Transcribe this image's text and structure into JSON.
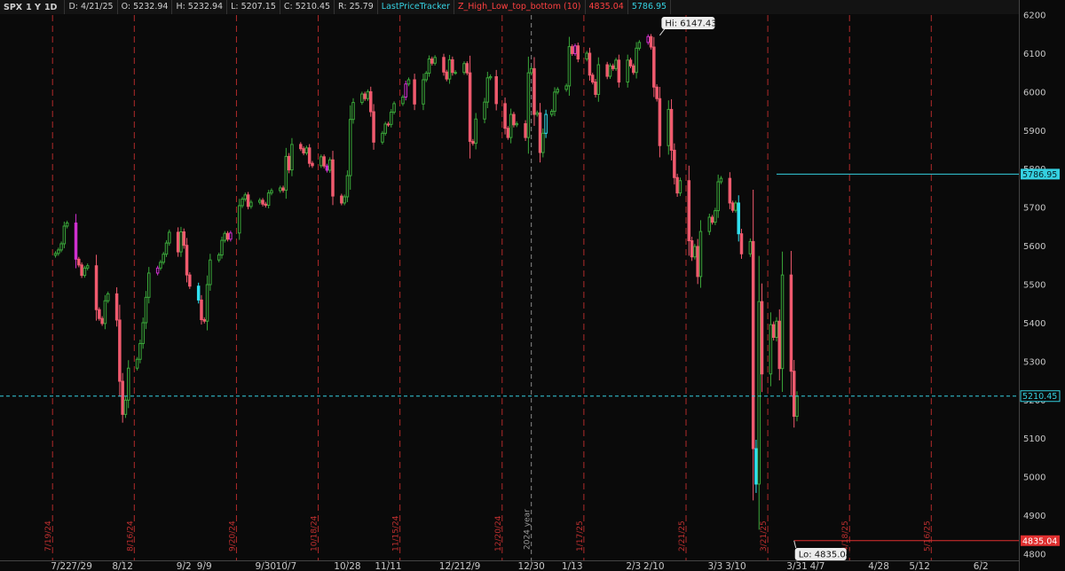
{
  "header": {
    "symbol": "SPX",
    "period": "1 Y",
    "interval": "1D",
    "date": "D: 4/21/25",
    "open": "O: 5232.94",
    "high": "H: 5232.94",
    "low": "L: 5207.15",
    "close": "C: 5210.45",
    "range": "R: 25.79",
    "study1": "LastPriceTracker",
    "study2": "Z_High_Low_top_bottom (10)",
    "study2_v1": "4835.04",
    "study2_v2": "5786.95"
  },
  "chart_data": {
    "type": "candlestick",
    "ylim": [
      4800,
      6200
    ],
    "y_ticks": [
      4800,
      4900,
      5000,
      5100,
      5200,
      5300,
      5400,
      5500,
      5600,
      5700,
      5800,
      5900,
      6000,
      6100,
      6200
    ],
    "x_ticks": [
      "7/22",
      "7/29",
      "8/12",
      "9/2",
      "9/9",
      "9/30",
      "10/7",
      "10/28",
      "11/11",
      "12/2",
      "12/9",
      "12/30",
      "1/13",
      "2/3",
      "2/10",
      "3/3",
      "3/10",
      "3/31",
      "4/7",
      "4/28",
      "5/12",
      "6/2"
    ],
    "x_tick_days": [
      2,
      9,
      23,
      44,
      51,
      72,
      79,
      100,
      114,
      135,
      142,
      163,
      177,
      198,
      205,
      226,
      233,
      254,
      261,
      282,
      296,
      317
    ],
    "x_range_days": [
      -19,
      330
    ],
    "year_divider": {
      "label": "2024 year",
      "day": 163
    },
    "markers": [
      {
        "label": "7/19/24",
        "day": -1
      },
      {
        "label": "8/16/24",
        "day": 27
      },
      {
        "label": "9/20/24",
        "day": 62
      },
      {
        "label": "10/18/24",
        "day": 90
      },
      {
        "label": "11/15/24",
        "day": 118
      },
      {
        "label": "12/20/24",
        "day": 153
      },
      {
        "label": "1/17/25",
        "day": 181
      },
      {
        "label": "2/21/25",
        "day": 216
      },
      {
        "label": "3/21/25",
        "day": 244
      },
      {
        "label": "4/18/25",
        "day": 272
      },
      {
        "label": "5/16/25",
        "day": 300
      }
    ],
    "last_price": {
      "value": 5210.45,
      "label": "5210.45"
    },
    "level_high": {
      "value": 5786.95,
      "label": "5786.95",
      "start_day": 247
    },
    "level_low": {
      "value": 4835.04,
      "label": "4835.04",
      "start_day": 253
    },
    "hi_callout": {
      "label": "Hi: 6147.43",
      "value": 6147.43,
      "day": 207
    },
    "lo_callout": {
      "label": "Lo: 4835.04",
      "value": 4835.04,
      "day": 253
    },
    "colors": {
      "up": "#3aa83a",
      "down": "#f05a6e",
      "hi_bar": "#d030d0",
      "lo_bar": "#30e0f0",
      "marker": "#b02a2a",
      "tracker": "#35d0e0",
      "level_low": "#e03030"
    },
    "closes": [
      [
        0,
        5581
      ],
      [
        1,
        5590
      ],
      [
        2,
        5606
      ],
      [
        3,
        5652
      ],
      [
        4,
        5660
      ],
      [
        7,
        5566
      ],
      [
        8,
        5551
      ],
      [
        9,
        5524
      ],
      [
        10,
        5543
      ],
      [
        11,
        5549
      ],
      [
        14,
        5435
      ],
      [
        15,
        5412
      ],
      [
        16,
        5399
      ],
      [
        17,
        5458
      ],
      [
        18,
        5476
      ],
      [
        21,
        5408
      ],
      [
        22,
        5249
      ],
      [
        23,
        5163
      ],
      [
        24,
        5200
      ],
      [
        25,
        5283
      ],
      [
        28,
        5306
      ],
      [
        29,
        5347
      ],
      [
        30,
        5401
      ],
      [
        31,
        5467
      ],
      [
        32,
        5530
      ],
      [
        35,
        5543
      ],
      [
        36,
        5558
      ],
      [
        37,
        5579
      ],
      [
        38,
        5608
      ],
      [
        39,
        5636
      ],
      [
        42,
        5585
      ],
      [
        43,
        5637
      ],
      [
        44,
        5602
      ],
      [
        45,
        5525
      ],
      [
        46,
        5496
      ],
      [
        49,
        5460
      ],
      [
        50,
        5409
      ],
      [
        51,
        5405
      ],
      [
        52,
        5500
      ],
      [
        53,
        5564
      ],
      [
        56,
        5577
      ],
      [
        57,
        5615
      ],
      [
        58,
        5633
      ],
      [
        59,
        5618
      ],
      [
        60,
        5634
      ],
      [
        63,
        5705
      ],
      [
        64,
        5722
      ],
      [
        65,
        5733
      ],
      [
        66,
        5703
      ],
      [
        67,
        5714
      ],
      [
        70,
        5719
      ],
      [
        71,
        5709
      ],
      [
        72,
        5706
      ],
      [
        73,
        5738
      ],
      [
        74,
        5744
      ],
      [
        77,
        5751
      ],
      [
        78,
        5745
      ],
      [
        79,
        5833
      ],
      [
        80,
        5798
      ],
      [
        81,
        5864
      ],
      [
        84,
        5853
      ],
      [
        85,
        5842
      ],
      [
        86,
        5855
      ],
      [
        87,
        5815
      ],
      [
        88,
        5809
      ],
      [
        91,
        5832
      ],
      [
        92,
        5808
      ],
      [
        93,
        5797
      ],
      [
        94,
        5824
      ],
      [
        95,
        5730
      ],
      [
        98,
        5712
      ],
      [
        99,
        5728
      ],
      [
        100,
        5783
      ],
      [
        101,
        5929
      ],
      [
        102,
        5973
      ],
      [
        105,
        5995
      ],
      [
        106,
        5983
      ],
      [
        107,
        6001
      ],
      [
        108,
        5949
      ],
      [
        109,
        5870
      ],
      [
        112,
        5893
      ],
      [
        113,
        5917
      ],
      [
        114,
        5916
      ],
      [
        115,
        5948
      ],
      [
        116,
        5970
      ],
      [
        119,
        5987
      ],
      [
        120,
        6021
      ],
      [
        121,
        6032
      ],
      [
        123,
        5969
      ],
      [
        126,
        6032
      ],
      [
        127,
        6049
      ],
      [
        128,
        6086
      ],
      [
        129,
        6075
      ],
      [
        130,
        6090
      ],
      [
        133,
        6052
      ],
      [
        134,
        6034
      ],
      [
        135,
        6084
      ],
      [
        136,
        6051
      ],
      [
        137,
        6051
      ],
      [
        140,
        6074
      ],
      [
        141,
        6050
      ],
      [
        142,
        5872
      ],
      [
        143,
        5867
      ],
      [
        144,
        5930
      ],
      [
        147,
        5974
      ],
      [
        148,
        6037
      ],
      [
        149,
        6040
      ],
      [
        151,
        5970
      ],
      [
        154,
        5906
      ],
      [
        155,
        5882
      ],
      [
        156,
        5942
      ],
      [
        157,
        5915
      ],
      [
        158,
        5918
      ],
      [
        161,
        5882
      ],
      [
        162,
        6050
      ],
      [
        163,
        6061
      ],
      [
        164,
        5942
      ],
      [
        165,
        5946
      ],
      [
        166,
        5843
      ],
      [
        167,
        5893
      ],
      [
        168,
        5942
      ],
      [
        170,
        5950
      ],
      [
        171,
        6000
      ],
      [
        172,
        6007
      ],
      [
        175,
        6016
      ],
      [
        176,
        6118
      ],
      [
        177,
        6100
      ],
      [
        178,
        6120
      ],
      [
        179,
        6086
      ],
      [
        182,
        6101
      ],
      [
        183,
        6044
      ],
      [
        184,
        6026
      ],
      [
        185,
        5994
      ],
      [
        186,
        6071
      ],
      [
        189,
        6041
      ],
      [
        190,
        6068
      ],
      [
        191,
        6061
      ],
      [
        192,
        6083
      ],
      [
        193,
        6026
      ],
      [
        196,
        6083
      ],
      [
        197,
        6068
      ],
      [
        198,
        6051
      ],
      [
        199,
        6114
      ],
      [
        200,
        6129
      ],
      [
        203,
        6144
      ],
      [
        204,
        6117
      ],
      [
        205,
        6013
      ],
      [
        206,
        5983
      ],
      [
        207,
        5861
      ],
      [
        210,
        5955
      ],
      [
        211,
        5849
      ],
      [
        212,
        5778
      ],
      [
        213,
        5738
      ],
      [
        214,
        5770
      ],
      [
        217,
        5614
      ],
      [
        218,
        5572
      ],
      [
        219,
        5599
      ],
      [
        220,
        5521
      ],
      [
        221,
        5638
      ],
      [
        224,
        5675
      ],
      [
        225,
        5662
      ],
      [
        226,
        5692
      ],
      [
        227,
        5767
      ],
      [
        228,
        5776
      ],
      [
        231,
        5712
      ],
      [
        232,
        5693
      ],
      [
        233,
        5712
      ],
      [
        234,
        5632
      ],
      [
        235,
        5580
      ],
      [
        238,
        5612
      ],
      [
        239,
        5074
      ],
      [
        240,
        4982
      ],
      [
        241,
        5456
      ],
      [
        242,
        5268
      ],
      [
        245,
        5396
      ],
      [
        246,
        5363
      ],
      [
        247,
        5405
      ],
      [
        248,
        5282
      ],
      [
        249,
        5525
      ],
      [
        252,
        5275
      ],
      [
        253,
        5158
      ],
      [
        254,
        5210
      ]
    ]
  }
}
